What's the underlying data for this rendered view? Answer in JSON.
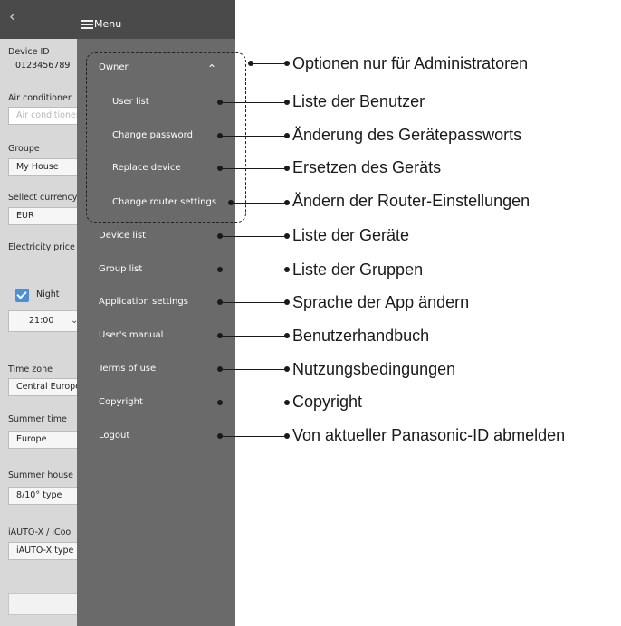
{
  "background": {
    "back_icon": "chevron-left-icon",
    "device_id_label": "Device ID",
    "device_id_value": "0123456789",
    "air_conditioner_label": "Air conditioner",
    "air_conditioner_placeholder": "Air conditioner",
    "groupe_label": "Groupe",
    "groupe_value": "My House",
    "currency_label": "Sellect currency",
    "currency_value": "EUR",
    "electricity_label": "Electricity price",
    "night_label": "Night",
    "night_checked": true,
    "night_time": "21:00",
    "time_zone_label": "Time zone",
    "time_zone_value": "Central European",
    "summer_time_label": "Summer time",
    "summer_time_value": "Europe",
    "summer_house_label": "Summer house",
    "summer_house_value": "8/10° type",
    "iauto_label": "iAUTO-X / iCool",
    "iauto_value": "iAUTO-X type"
  },
  "menu": {
    "title": "Menu",
    "owner_label": "Owner",
    "owner_submenu": [
      "User list",
      "Change password",
      "Replace device",
      "Change router settings"
    ],
    "items": [
      "Device list",
      "Group list",
      "Application settings",
      "User's manual",
      "Terms of use",
      "Copyright",
      "Logout"
    ]
  },
  "annotations": [
    "Optionen nur für Administratoren",
    "Liste der Benutzer",
    "Änderung des Gerätepassworts",
    "Ersetzen des Geräts",
    "Ändern der Router-Einstellungen",
    "Liste der Geräte",
    "Liste der Gruppen",
    "Sprache der App ändern",
    "Benutzerhandbuch",
    "Nutzungsbedingungen",
    "Copyright",
    "Von aktueller Panasonic-ID abmelden"
  ],
  "colors": {
    "menu_bg": "#6a6a6a",
    "header_bg": "#4a4a4a",
    "checkbox": "#4a90d9"
  }
}
